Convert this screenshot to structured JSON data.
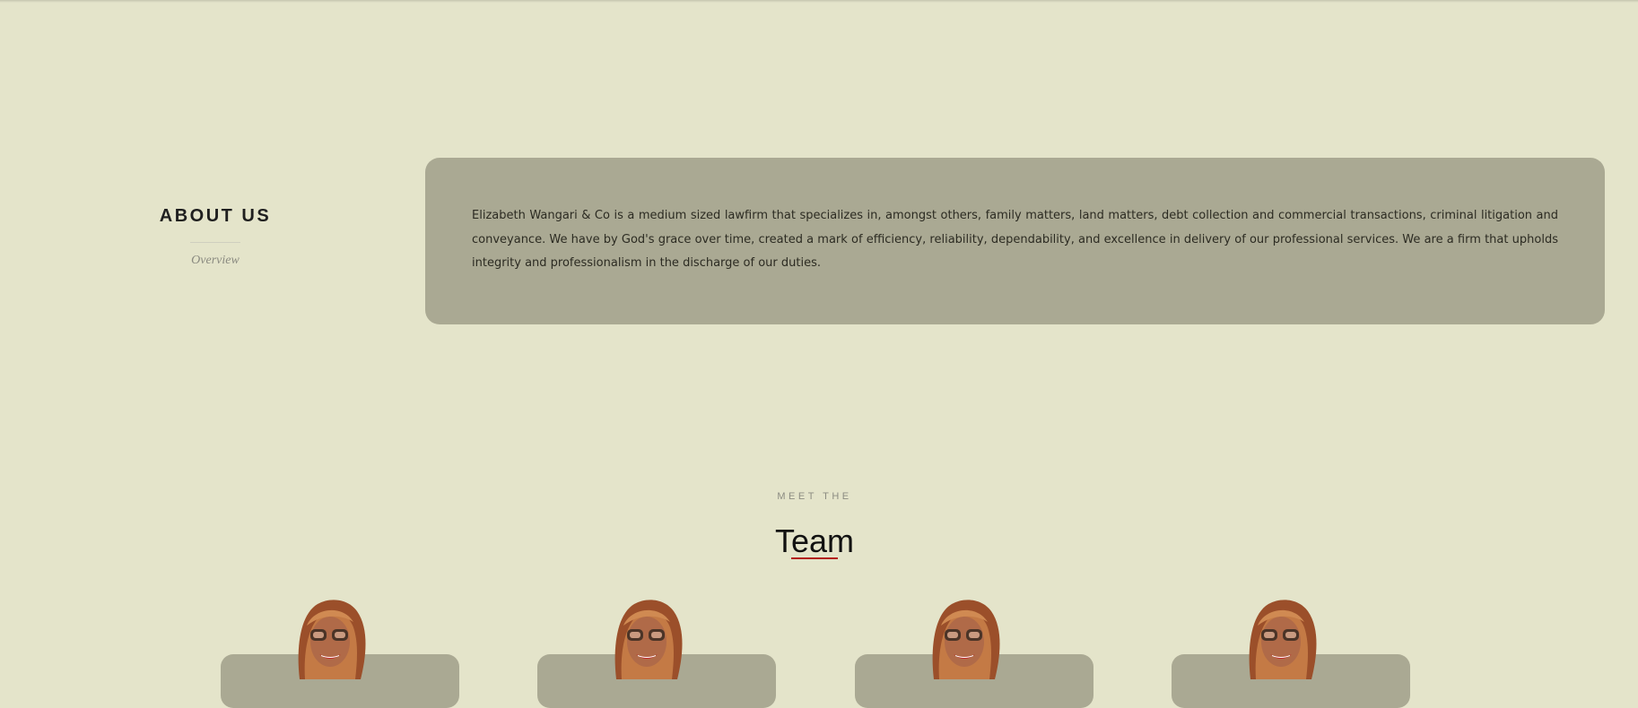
{
  "about": {
    "title": "ABOUT US",
    "subtitle": "Overview",
    "text": "Elizabeth Wangari & Co is a medium sized lawfirm that specializes in, amongst others, family matters, land matters, debt collection and commercial transactions, criminal litigation and conveyance. We have by God's grace over time, created a mark of efficiency, reliability, dependability, and excellence in delivery of our professional services. We are a firm that upholds integrity and professionalism in the discharge of our duties."
  },
  "team": {
    "kicker": "MEET THE",
    "title": "Team",
    "members": [
      {
        "photo": "team-member-portrait"
      },
      {
        "photo": "team-member-portrait"
      },
      {
        "photo": "team-member-portrait"
      },
      {
        "photo": "team-member-portrait"
      }
    ]
  },
  "colors": {
    "page_background": "#e4e4ca",
    "card_background": "#aaa993",
    "accent_underline": "#b31d1d"
  }
}
